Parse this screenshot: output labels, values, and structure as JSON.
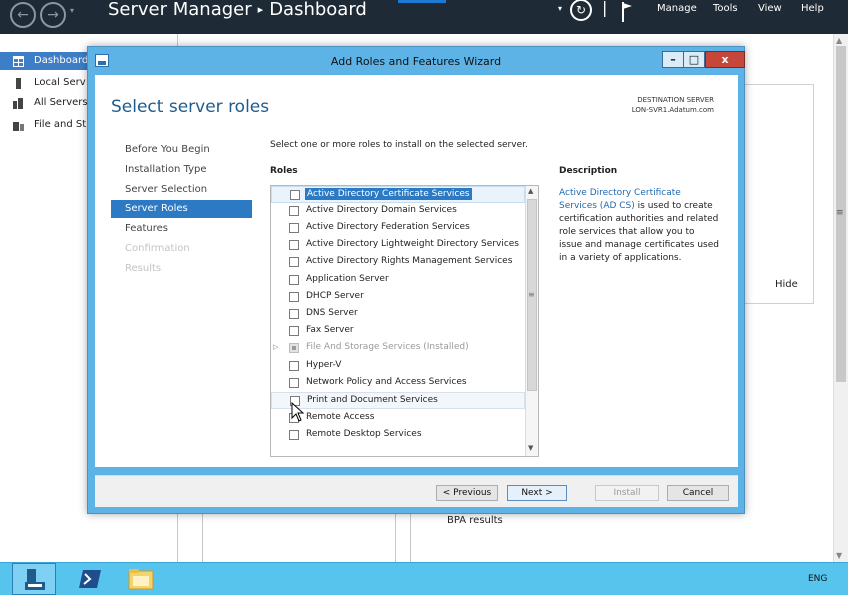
{
  "server_manager": {
    "title": "Server Manager",
    "breadcrumb": "Dashboard",
    "menu": [
      "Manage",
      "Tools",
      "View",
      "Help"
    ],
    "nav": [
      {
        "label": "Dashboard",
        "active": true
      },
      {
        "label": "Local Serv",
        "active": false
      },
      {
        "label": "All Servers",
        "active": false
      },
      {
        "label": "File and St",
        "active": false
      }
    ],
    "hide_label": "Hide",
    "bpa_label": "BPA results"
  },
  "wizard": {
    "title": "Add Roles and Features Wizard",
    "heading": "Select server roles",
    "destination_label": "DESTINATION SERVER",
    "destination_name": "LON-SVR1.Adatum.com",
    "steps": [
      {
        "label": "Before You Begin",
        "state": "normal"
      },
      {
        "label": "Installation Type",
        "state": "normal"
      },
      {
        "label": "Server Selection",
        "state": "normal"
      },
      {
        "label": "Server Roles",
        "state": "active"
      },
      {
        "label": "Features",
        "state": "normal"
      },
      {
        "label": "Confirmation",
        "state": "disabled"
      },
      {
        "label": "Results",
        "state": "disabled"
      }
    ],
    "instruction": "Select one or more roles to install on the selected server.",
    "roles_heading": "Roles",
    "description_heading": "Description",
    "roles": [
      {
        "label": "Active Directory Certificate Services",
        "selected": true
      },
      {
        "label": "Active Directory Domain Services"
      },
      {
        "label": "Active Directory Federation Services"
      },
      {
        "label": "Active Directory Lightweight Directory Services"
      },
      {
        "label": "Active Directory Rights Management Services"
      },
      {
        "label": "Application Server"
      },
      {
        "label": "DHCP Server"
      },
      {
        "label": "DNS Server"
      },
      {
        "label": "Fax Server"
      },
      {
        "label": "File And Storage Services (Installed)",
        "installed": true
      },
      {
        "label": "Hyper-V"
      },
      {
        "label": "Network Policy and Access Services"
      },
      {
        "label": "Print and Document Services",
        "hovered": true
      },
      {
        "label": "Remote Access"
      },
      {
        "label": "Remote Desktop Services"
      }
    ],
    "description": {
      "link": "Active Directory Certificate Services (AD CS)",
      "text": " is used to create certification authorities and related role services that allow you to issue and manage certificates used in a variety of applications."
    },
    "buttons": {
      "previous": "< Previous",
      "next": "Next >",
      "install": "Install",
      "cancel": "Cancel"
    },
    "window_buttons": {
      "minimize": "–",
      "maximize": "□",
      "close": "x"
    }
  },
  "taskbar": {
    "language": "ENG"
  },
  "colors": {
    "accent": "#2d7ac4",
    "titlebar": "#1e2a35",
    "taskbar": "#57c4ee",
    "wizard_frame": "#5eb3e6"
  }
}
